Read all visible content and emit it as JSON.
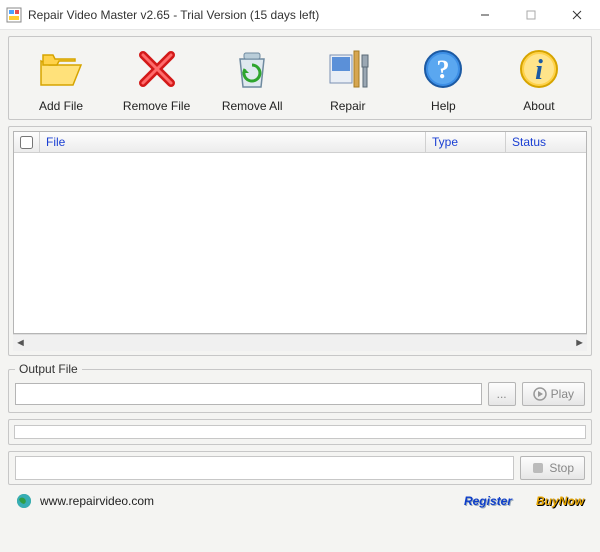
{
  "window": {
    "title": "Repair Video Master v2.65 - Trial Version (15 days left)"
  },
  "toolbar": {
    "addFile": "Add File",
    "removeFile": "Remove File",
    "removeAll": "Remove All",
    "repair": "Repair",
    "help": "Help",
    "about": "About"
  },
  "columns": {
    "file": "File",
    "type": "Type",
    "status": "Status"
  },
  "output": {
    "legend": "Output File",
    "value": "",
    "browse": "...",
    "play": "Play"
  },
  "stop": {
    "label": "Stop"
  },
  "footer": {
    "url": "www.repairvideo.com",
    "register": "Register",
    "buy": "BuyNow"
  }
}
